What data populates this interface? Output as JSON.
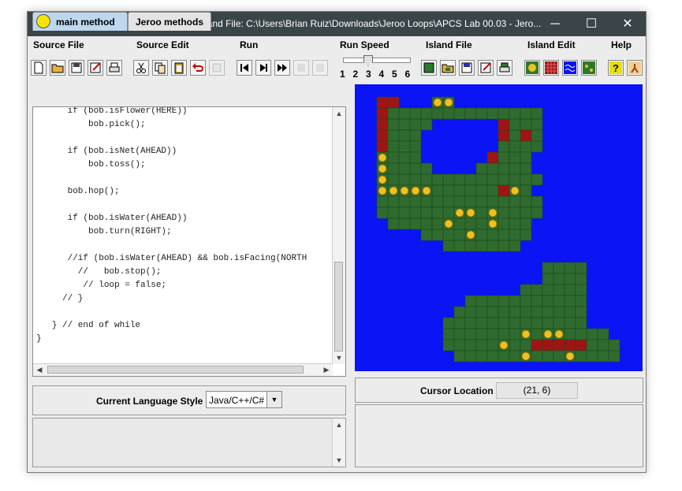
{
  "window": {
    "title": "Jeroo's World -- Source File: none     Island File: C:\\Users\\Brian Ruiz\\Downloads\\Jeroo Loops\\APCS Lab 00.03 - Jero...",
    "minimize": "─",
    "maximize": "☐",
    "close": "✕"
  },
  "menu": [
    "Source File",
    "Source Edit",
    "Run",
    "Run Speed",
    "Island File",
    "Island Edit",
    "Help"
  ],
  "toolbar": {
    "speed_labels": [
      "1",
      "2",
      "3",
      "4",
      "5",
      "6"
    ],
    "speed_value": 3,
    "icons": [
      "new-file-icon",
      "open-file-icon",
      "save-file-icon",
      "save-as-icon",
      "print-icon",
      "cut-icon",
      "copy-icon",
      "paste-icon",
      "undo-icon",
      "redo-icon",
      "reset-icon",
      "step-icon",
      "run-icon",
      "pause-icon",
      "stop-icon",
      "island-new-icon",
      "island-open-icon",
      "island-save-icon",
      "island-save-as-icon",
      "island-print-icon",
      "flower-icon",
      "net-icon",
      "water-icon",
      "land-icon",
      "help-icon",
      "exit-icon"
    ]
  },
  "tabs": {
    "main": "main method",
    "jeroo": "Jeroo methods"
  },
  "code": "      if (bob.isFlower(HERE))\n          bob.pick();\n\n      if (bob.isNet(AHEAD))\n          bob.toss();\n\n      bob.hop();\n\n      if (bob.isWater(AHEAD))\n          bob.turn(RIGHT);\n\n      //if (bob.isWater(AHEAD) && bob.isFacing(NORTH\n        //   bob.stop();\n         // loop = false;\n     // }\n\n   } // end of while\n}",
  "language": {
    "label": "Current Language Style",
    "value": "Java/C++/C#"
  },
  "cursor": {
    "label": "Cursor Location",
    "value": "(21, 6)"
  },
  "colors": {
    "water": "#0a14f5",
    "grass": "#2f6b2f",
    "net": "#a01414",
    "flower": "#f0c020"
  },
  "island_rows": [
    "..NN...FF.......",
    "..NLLLLLLLLLLLLLL",
    "..NLLLL......NLLL",
    "..NLLL.......NLNL",
    "..NLLL.......LLLL",
    "..FLLL......NLLL",
    "..FLLLL....LLLLL",
    "..FLLLLLLLLLLLLLL",
    "..FFFFFLLLLLLNFL",
    "..LLLLLLLLLLLLLLL",
    "..LLLLLLLFFLFLLLL",
    "...LLLLLFLLLFLLL",
    "......LLLLFLLLLL",
    "........LLLLLLL",
    "................",
    ".................LLLL",
    ".................LLLL",
    "...............LLLLLL",
    "..........LLLLLLLLLLL",
    ".........LLLLLLLLLLLL",
    "........LLLLLLLLLLLLL",
    "........LLLLLLLFLFFLLLL",
    "........LLLLLFLLNNNNNLLL",
    ".........LLLLLLFLLLFLLLL",
    "..........LLLLLFLLLLLLL"
  ]
}
